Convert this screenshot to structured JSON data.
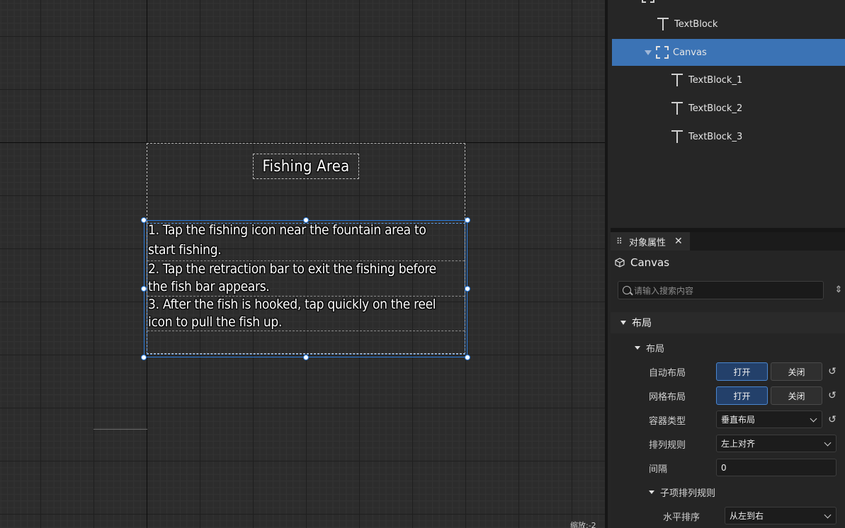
{
  "viewport": {
    "title_text": "Fishing Area",
    "lines": [
      "1. Tap the fishing icon near the fountain area to",
      "start fishing.",
      "2. Tap the retraction bar to exit the fishing before",
      "the fish bar appears.",
      "3. After the fish is hooked, tap quickly on the reel",
      "icon to pull the fish up."
    ],
    "zoom_label": "缩放:-2"
  },
  "hierarchy": {
    "items": [
      {
        "label": "TextBlock",
        "icon": "text-icon"
      },
      {
        "label": "Canvas",
        "icon": "canvas-icon",
        "selected": true,
        "expanded": true
      },
      {
        "label": "TextBlock_1",
        "icon": "text-icon"
      },
      {
        "label": "TextBlock_2",
        "icon": "text-icon"
      },
      {
        "label": "TextBlock_3",
        "icon": "text-icon"
      }
    ]
  },
  "properties": {
    "tab_label": "对象属性",
    "object_name": "Canvas",
    "search_placeholder": "请输入搜索内容",
    "section_label": "布局",
    "subsection_label": "布局",
    "auto_layout_label": "自动布局",
    "grid_layout_label": "网格布局",
    "on_label": "打开",
    "off_label": "关闭",
    "container_type_label": "容器类型",
    "container_type_value": "垂直布局",
    "arrange_rule_label": "排列规则",
    "arrange_rule_value": "左上对齐",
    "spacing_label": "间隔",
    "spacing_value": "0",
    "child_rule_label": "子项排列规则",
    "horizontal_order_label": "水平排序",
    "horizontal_order_value": "从左到右"
  },
  "colors": {
    "selection": "#3b73b5",
    "toggle_on": "#23406a"
  }
}
